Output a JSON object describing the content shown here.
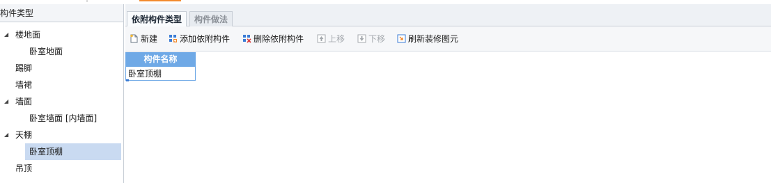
{
  "left_panel": {
    "title": "构件类型",
    "tree": [
      {
        "label": "楼地面",
        "level": 1,
        "expanded": true
      },
      {
        "label": "卧室地面",
        "level": 2
      },
      {
        "label": "踢脚",
        "level": 1
      },
      {
        "label": "墙裙",
        "level": 1
      },
      {
        "label": "墙面",
        "level": 1,
        "expanded": true
      },
      {
        "label": "卧室墙面 [内墙面]",
        "level": 2
      },
      {
        "label": "天棚",
        "level": 1,
        "expanded": true
      },
      {
        "label": "卧室顶棚",
        "level": 2,
        "selected": true
      },
      {
        "label": "吊顶",
        "level": 1
      }
    ]
  },
  "tabs": [
    {
      "label": "依附构件类型",
      "active": true
    },
    {
      "label": "构件做法",
      "active": false
    }
  ],
  "toolbar": {
    "new_label": "新建",
    "add_label": "添加依附构件",
    "delete_label": "删除依附构件",
    "up_label": "上移",
    "down_label": "下移",
    "refresh_label": "刷新装修图元"
  },
  "grid": {
    "header": "构件名称",
    "rows": [
      "卧室顶棚"
    ]
  },
  "colors": {
    "accent": "#6fa9e6",
    "selection": "#c9daf1",
    "top_strip": "#f28a2e"
  }
}
